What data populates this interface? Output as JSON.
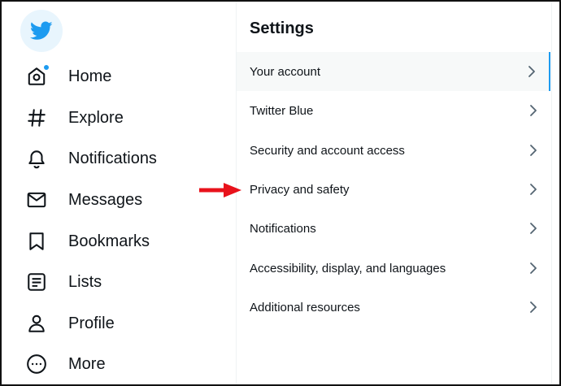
{
  "colors": {
    "accent": "#1d9bf0",
    "text": "#0f1419",
    "annotation_arrow": "#e8121b",
    "active_row_bg": "#f7f9f9"
  },
  "logo": {
    "icon": "twitter-bird-icon"
  },
  "nav": {
    "items": [
      {
        "label": "Home",
        "icon": "home-icon"
      },
      {
        "label": "Explore",
        "icon": "hashtag-icon"
      },
      {
        "label": "Notifications",
        "icon": "bell-icon"
      },
      {
        "label": "Messages",
        "icon": "envelope-icon"
      },
      {
        "label": "Bookmarks",
        "icon": "bookmark-icon"
      },
      {
        "label": "Lists",
        "icon": "list-icon"
      },
      {
        "label": "Profile",
        "icon": "person-icon"
      },
      {
        "label": "More",
        "icon": "more-circle-icon"
      }
    ]
  },
  "settings": {
    "title": "Settings",
    "items": [
      {
        "label": "Your account",
        "selected": true
      },
      {
        "label": "Twitter Blue",
        "selected": false
      },
      {
        "label": "Security and account access",
        "selected": false
      },
      {
        "label": "Privacy and safety",
        "selected": false
      },
      {
        "label": "Notifications",
        "selected": false
      },
      {
        "label": "Accessibility, display, and languages",
        "selected": false
      },
      {
        "label": "Additional resources",
        "selected": false
      }
    ]
  }
}
